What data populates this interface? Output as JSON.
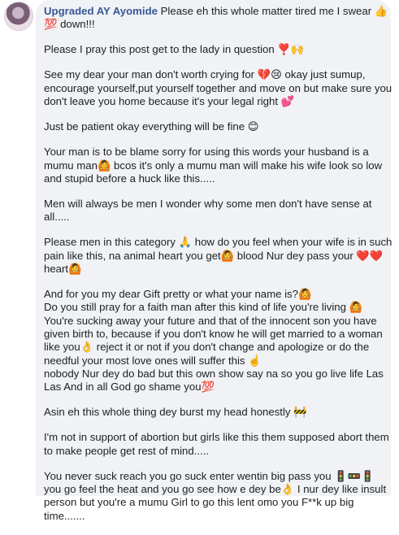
{
  "comment": {
    "author": "Upgraded AY Ayomide",
    "paragraphs": [
      "Please eh this whole matter tired me I swear 👍💯 down!!!",
      "Please I pray this post get to the lady in question ❣️🙌",
      "See my dear your man don't worth crying for 💔😢 okay just sumup, encourage yourself,put yourself together and move on but make sure you don't leave you home because it's your legal right 💕",
      "Just be patient okay everything will be fine 😊",
      "Your man is to be blame sorry for using this words your husband is a mumu man🙆 bcos it's only a mumu man will make his wife look so low and stupid before a huck like this.....",
      "Men will always be men I wonder why some men don't have sense at all.....",
      "Please men in this category 🙏 how do you feel when your wife is in such pain like this, na animal heart you get🙆 blood Nur dey pass your ❤️❤️ heart🙆",
      "And for you my dear Gift pretty or what your name is?🙆\nDo you still pray for a faith man after this kind of life you're living 🙆\nYou're sucking away your future and that of the innocent son you have given birth to, because if you don't know he will get married to a woman like you👌 reject it or not if you don't change and apologize or do the needful your most love ones will suffer this ☝️\nnobody Nur dey do bad but this own show say na so you go live life Las Las And in all God go shame you💯",
      "Asin eh this whole thing dey burst my head honestly 🚧",
      "I'm not in support of abortion but girls like this them supposed abort them to make people get rest of mind.....",
      "You never suck reach you go suck enter wentin big pass you 🚦🚥🚦 you go feel the heat and you go see how e dey be👌 I nur dey like insult person but you're a mumu Girl to go this lent omo you F**k up big time......."
    ]
  }
}
